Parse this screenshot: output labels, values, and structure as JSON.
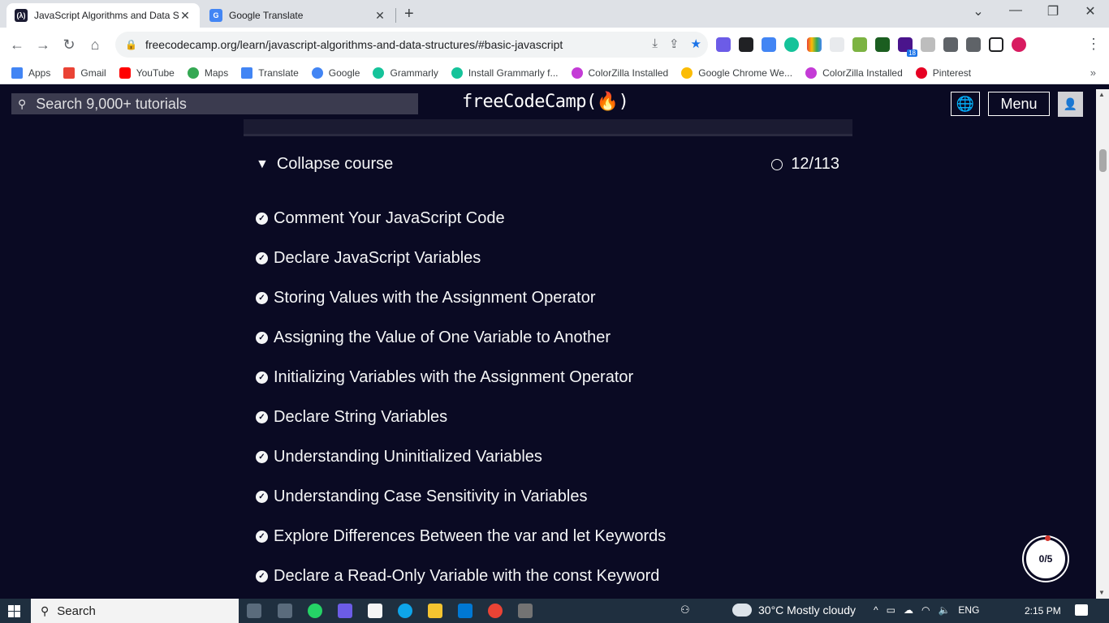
{
  "browser": {
    "tabs": [
      {
        "title": "JavaScript Algorithms and Data S",
        "favicon": "fcc-icon",
        "active": true
      },
      {
        "title": "Google Translate",
        "favicon": "google-translate-icon",
        "active": false
      }
    ],
    "new_tab": "+",
    "window_controls": {
      "dropdown": "⌄",
      "minimize": "—",
      "restore": "❐",
      "close": "✕"
    },
    "url": "freecodecamp.org/learn/javascript-algorithms-and-data-structures/#basic-javascript",
    "extension_badge": "18",
    "bookmarks": [
      {
        "label": "Apps",
        "icon": "apps-grid-icon",
        "color": "#4285f4"
      },
      {
        "label": "Gmail",
        "icon": "gmail-icon",
        "color": "#ea4335"
      },
      {
        "label": "YouTube",
        "icon": "youtube-icon",
        "color": "#ff0000"
      },
      {
        "label": "Maps",
        "icon": "maps-pin-icon",
        "color": "#34a853"
      },
      {
        "label": "Translate",
        "icon": "translate-icon",
        "color": "#4285f4"
      },
      {
        "label": "Google",
        "icon": "google-icon",
        "color": "#4285f4"
      },
      {
        "label": "Grammarly",
        "icon": "grammarly-icon",
        "color": "#15c39a"
      },
      {
        "label": "Install Grammarly f...",
        "icon": "grammarly-icon",
        "color": "#15c39a"
      },
      {
        "label": "ColorZilla Installed",
        "icon": "colorzilla-icon",
        "color": "#c43bd6"
      },
      {
        "label": "Google Chrome We...",
        "icon": "chrome-icon",
        "color": "#fbbc05"
      },
      {
        "label": "ColorZilla Installed",
        "icon": "colorzilla-icon",
        "color": "#c43bd6"
      },
      {
        "label": "Pinterest",
        "icon": "pinterest-icon",
        "color": "#e60023"
      }
    ],
    "bookmarks_more": "»"
  },
  "fcc_header": {
    "search_placeholder": "Search 9,000+ tutorials",
    "logo": "freeCodeCamp(🔥)",
    "menu_label": "Menu"
  },
  "course": {
    "collapse_label": "Collapse course",
    "progress": "12/113",
    "lessons": [
      "Comment Your JavaScript Code",
      "Declare JavaScript Variables",
      "Storing Values with the Assignment Operator",
      "Assigning the Value of One Variable to Another",
      "Initializing Variables with the Assignment Operator",
      "Declare String Variables",
      "Understanding Uninitialized Variables",
      "Understanding Case Sensitivity in Variables",
      "Explore Differences Between the var and let Keywords",
      "Declare a Read-Only Variable with the const Keyword"
    ]
  },
  "badge": {
    "value": "0/5"
  },
  "taskbar": {
    "search_label": "Search",
    "weather": "30°C  Mostly cloudy",
    "language": "ENG",
    "time": "2:15 PM"
  },
  "colors": {
    "fcc_background": "#0a0a23",
    "fcc_search_bg": "#3b3b4f",
    "text_light": "#f5f6f7",
    "chrome_tabstrip": "#dee1e6",
    "taskbar": "#1f2f3f"
  }
}
